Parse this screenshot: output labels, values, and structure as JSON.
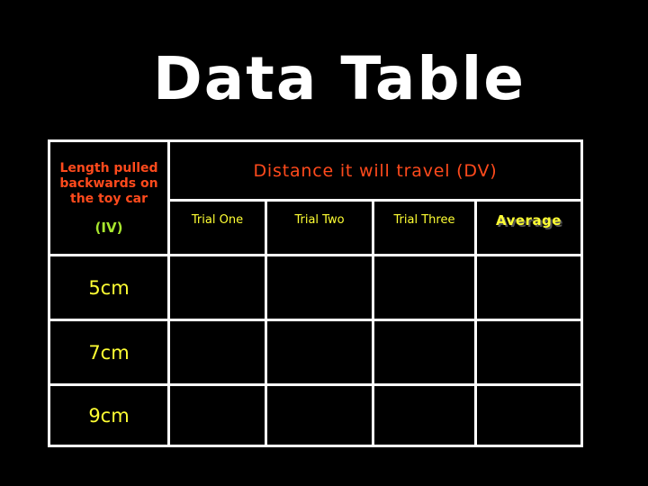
{
  "title": "Data Table",
  "table": {
    "iv_header": {
      "lines": [
        "Length pulled",
        "backwards on",
        "the toy car"
      ],
      "tag": "(IV)"
    },
    "dv_header": "Distance it will travel (DV)",
    "columns": [
      "Trial One",
      "Trial Two",
      "Trial Three",
      "Average"
    ],
    "rows": [
      {
        "label": "5cm",
        "values": [
          "",
          "",
          "",
          ""
        ]
      },
      {
        "label": "7cm",
        "values": [
          "",
          "",
          "",
          ""
        ]
      },
      {
        "label": "9cm",
        "values": [
          "",
          "",
          "",
          ""
        ]
      }
    ]
  },
  "colors": {
    "background": "#000000",
    "title": "#ffffff",
    "iv_header": "#ff4a1c",
    "iv_tag": "#a8e62e",
    "dv_header": "#ff4a1c",
    "column_text": "#ffff33",
    "row_label": "#ffff33",
    "grid_lines": "#ffffff"
  }
}
